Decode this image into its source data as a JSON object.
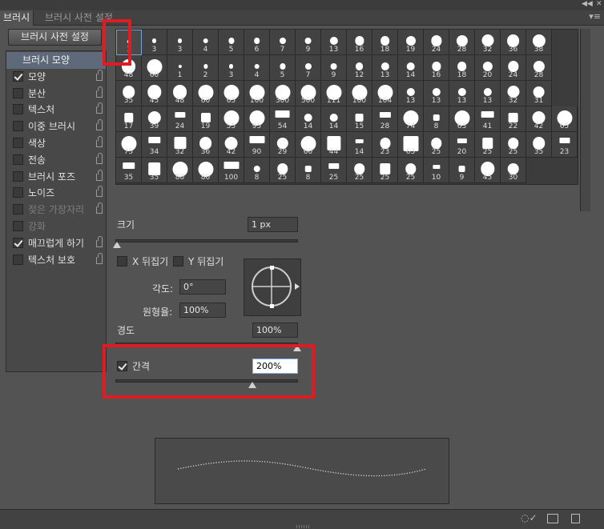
{
  "tabs": {
    "active": "브러시",
    "inactive": "브러시 사전 설정"
  },
  "preset_button": "브러시 사전 설정",
  "options": [
    {
      "label": "브러시 모양",
      "header": true
    },
    {
      "label": "모양",
      "checked": true,
      "lock": true
    },
    {
      "label": "분산",
      "checked": false,
      "lock": true
    },
    {
      "label": "텍스처",
      "checked": false,
      "lock": true
    },
    {
      "label": "이중 브러시",
      "checked": false,
      "lock": true
    },
    {
      "label": "색상",
      "checked": false,
      "lock": true
    },
    {
      "label": "전송",
      "checked": false,
      "lock": true
    },
    {
      "label": "브러시 포즈",
      "checked": false,
      "lock": true
    },
    {
      "label": "노이즈",
      "checked": false,
      "lock": true
    },
    {
      "label": "젖은 가장자리",
      "checked": false,
      "lock": true,
      "dim": true
    },
    {
      "label": "강화",
      "checked": false,
      "lock": false,
      "dim": true
    },
    {
      "label": "매끄럽게 하기",
      "checked": true,
      "lock": true
    },
    {
      "label": "텍스처 보호",
      "checked": false,
      "lock": true
    }
  ],
  "brush_grid": [
    [
      "1",
      "3",
      "3",
      "4",
      "5",
      "6",
      "7",
      "9",
      "13",
      "16",
      "18",
      "19",
      "24",
      "28",
      "32",
      "36",
      "38"
    ],
    [
      "48",
      "60",
      "1",
      "2",
      "3",
      "4",
      "5",
      "7",
      "9",
      "12",
      "13",
      "14",
      "16",
      "18",
      "20",
      "24",
      "28"
    ],
    [
      "35",
      "45",
      "48",
      "60",
      "65",
      "100",
      "300",
      "500",
      "111",
      "100",
      "104",
      "13",
      "13",
      "13",
      "13",
      "32",
      "31"
    ],
    [
      "17",
      "39",
      "24",
      "19",
      "55",
      "95",
      "54",
      "14",
      "14",
      "15",
      "28",
      "74",
      "8",
      "63",
      "41",
      "22",
      "42",
      "65"
    ],
    [
      "75",
      "34",
      "32",
      "36",
      "42",
      "90",
      "29",
      "60",
      "44",
      "14",
      "23",
      "63",
      "25",
      "20",
      "25",
      "25",
      "35",
      "23"
    ],
    [
      "35",
      "35",
      "80",
      "80",
      "100",
      "8",
      "25",
      "8",
      "25",
      "25",
      "25",
      "25",
      "10",
      "9",
      "45",
      "30"
    ]
  ],
  "size": {
    "label": "크기",
    "value": "1 px"
  },
  "flip_x": "X 뒤집기",
  "flip_y": "Y 뒤집기",
  "angle": {
    "label": "각도:",
    "value": "0°"
  },
  "roundness": {
    "label": "원형율:",
    "value": "100%"
  },
  "hardness": {
    "label": "경도",
    "value": "100%"
  },
  "spacing": {
    "label": "간격",
    "value": "200%",
    "checked": true
  },
  "colors": {
    "highlight": "#e01b24",
    "panel": "#535353"
  }
}
